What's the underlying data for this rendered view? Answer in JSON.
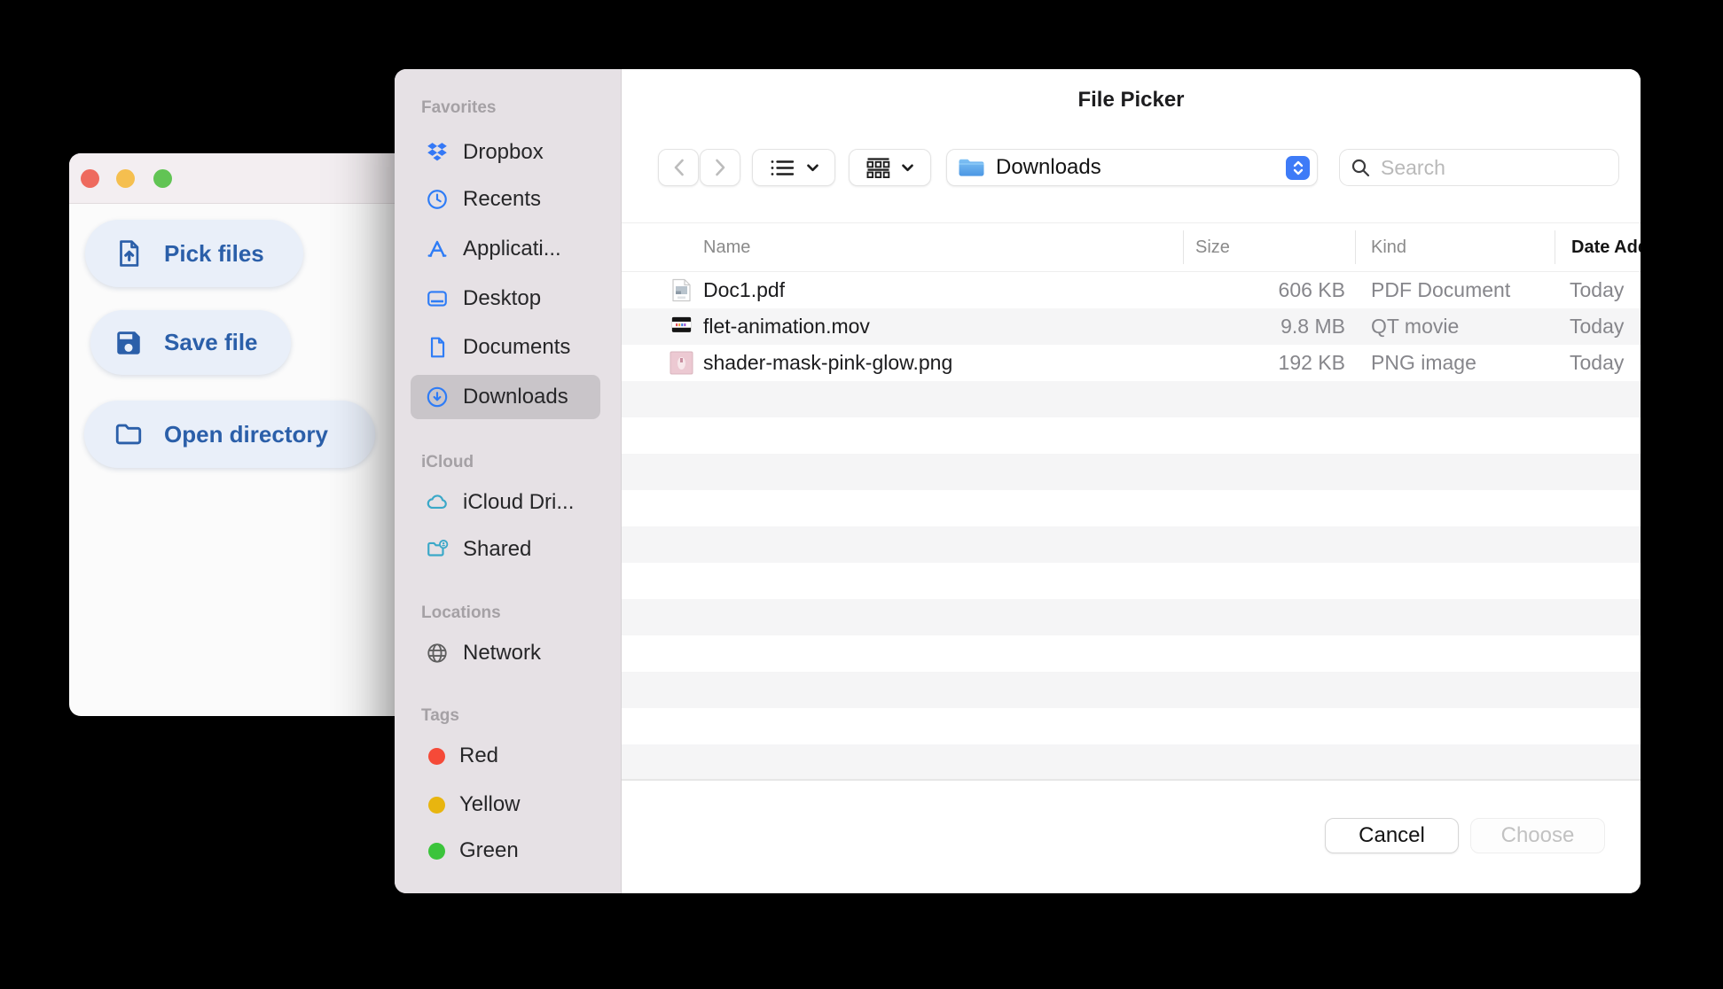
{
  "colors": {
    "traffic_red": "#ee6a5e",
    "traffic_yellow": "#f5bf4f",
    "traffic_green": "#61c454",
    "accent_blue": "#2b5fa9",
    "sidebar_icon_blue": "#2e7cf6",
    "icloud_teal": "#3aa8c8",
    "stepper_blue": "#3e7bf7",
    "tag_red": "#f54a38",
    "tag_yellow": "#e8b50f",
    "tag_green": "#3bc43b"
  },
  "app_window": {
    "buttons": [
      {
        "label": "Pick files",
        "icon": "upload-file-icon"
      },
      {
        "label": "Save file",
        "icon": "save-icon"
      },
      {
        "label": "Open directory",
        "icon": "folder-outline-icon"
      }
    ]
  },
  "dialog": {
    "title": "File Picker",
    "toolbar": {
      "path_label": "Downloads",
      "path_icon": "folder-icon",
      "search_placeholder": "Search"
    },
    "sidebar": {
      "sections": [
        {
          "title": "Favorites",
          "items": [
            {
              "label": "Dropbox",
              "icon": "dropbox-icon"
            },
            {
              "label": "Recents",
              "icon": "clock-icon"
            },
            {
              "label": "Applicati...",
              "icon": "app-store-icon"
            },
            {
              "label": "Desktop",
              "icon": "desktop-icon"
            },
            {
              "label": "Documents",
              "icon": "document-icon"
            },
            {
              "label": "Downloads",
              "icon": "downloads-circle-icon",
              "selected": true
            }
          ]
        },
        {
          "title": "iCloud",
          "items": [
            {
              "label": "iCloud Dri...",
              "icon": "cloud-icon"
            },
            {
              "label": "Shared",
              "icon": "shared-folder-icon"
            }
          ]
        },
        {
          "title": "Locations",
          "items": [
            {
              "label": "Network",
              "icon": "globe-icon"
            }
          ]
        },
        {
          "title": "Tags",
          "items": [
            {
              "label": "Red",
              "icon": "tag-dot",
              "color": "#f54a38"
            },
            {
              "label": "Yellow",
              "icon": "tag-dot",
              "color": "#e8b50f"
            },
            {
              "label": "Green",
              "icon": "tag-dot",
              "color": "#3bc43b"
            }
          ]
        }
      ]
    },
    "table": {
      "columns": [
        {
          "label": "Name"
        },
        {
          "label": "Size"
        },
        {
          "label": "Kind"
        },
        {
          "label": "Date Added",
          "sorted": true
        }
      ],
      "rows": [
        {
          "name": "Doc1.pdf",
          "size": "606 KB",
          "kind": "PDF Document",
          "date_added": "Today",
          "icon": "pdf-file-icon"
        },
        {
          "name": "flet-animation.mov",
          "size": "9.8 MB",
          "kind": "QT movie",
          "date_added": "Today",
          "icon": "movie-file-icon"
        },
        {
          "name": "shader-mask-pink-glow.png",
          "size": "192 KB",
          "kind": "PNG image",
          "date_added": "Today",
          "icon": "image-file-icon"
        }
      ]
    },
    "footer": {
      "cancel_label": "Cancel",
      "choose_label": "Choose"
    }
  }
}
